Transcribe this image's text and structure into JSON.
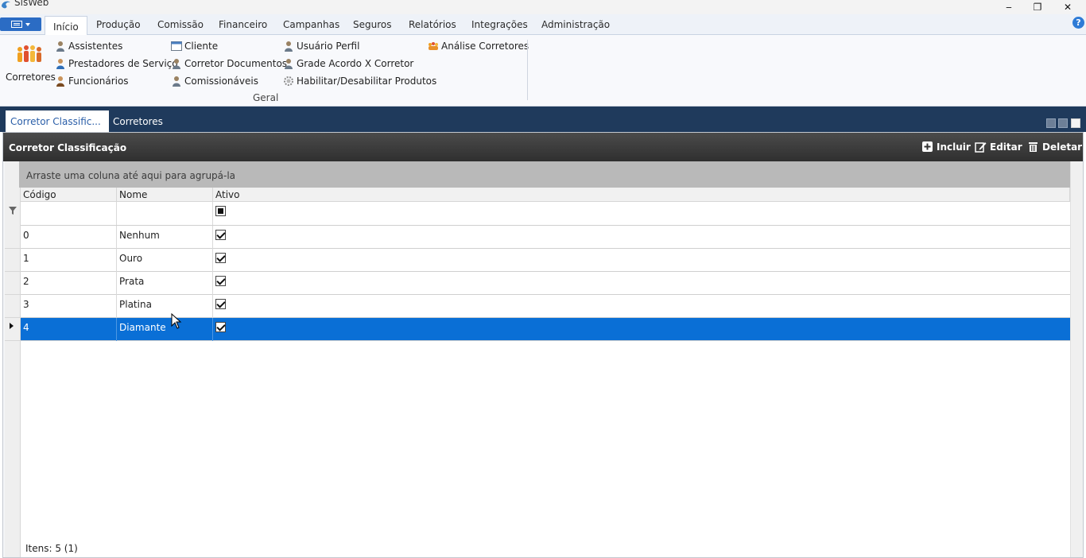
{
  "window": {
    "title": "SisWeb",
    "minimize": "‒",
    "maximize": "❐",
    "close": "✕"
  },
  "ribbon": {
    "tabs": [
      "Início",
      "Produção",
      "Comissão",
      "Financeiro",
      "Campanhas",
      "Seguros",
      "Relatórios",
      "Integrações",
      "Administração"
    ],
    "active_tab": "Início",
    "help": "?",
    "big_button": "Corretores",
    "items": {
      "assistentes": "Assistentes",
      "prestadores": "Prestadores de Serviço",
      "funcionarios": "Funcionários",
      "cliente": "Cliente",
      "corretor_documentos": "Corretor Documentos",
      "comissionaveis": "Comissionáveis",
      "usuario_perfil": "Usuário Perfil",
      "grade_acordo": "Grade Acordo X Corretor",
      "habilitar": "Habilitar/Desabilitar Produtos",
      "analise": "Análise Corretores"
    },
    "group_label": "Geral"
  },
  "doc_tabs": [
    "Corretor Classific...",
    "Corretores"
  ],
  "panel": {
    "title": "Corretor Classificação",
    "toolbar": {
      "incluir": "Incluir",
      "editar": "Editar",
      "deletar": "Deletar"
    }
  },
  "grid": {
    "group_hint": "Arraste uma coluna até aqui para agrupá-la",
    "columns": [
      "Código",
      "Nome",
      "Ativo"
    ],
    "rows": [
      {
        "codigo": "0",
        "nome": "Nenhum",
        "ativo": true
      },
      {
        "codigo": "1",
        "nome": "Ouro",
        "ativo": true
      },
      {
        "codigo": "2",
        "nome": "Prata",
        "ativo": true
      },
      {
        "codigo": "3",
        "nome": "Platina",
        "ativo": true
      },
      {
        "codigo": "4",
        "nome": "Diamante",
        "ativo": true
      }
    ],
    "selected_row": 4,
    "status": "Itens: 5 (1)"
  },
  "colors": {
    "accent": "#2b6cc4",
    "dark_band": "#1f3a5c",
    "selected_row": "#0a6fd6",
    "panel_header": "#3a3a3a"
  }
}
